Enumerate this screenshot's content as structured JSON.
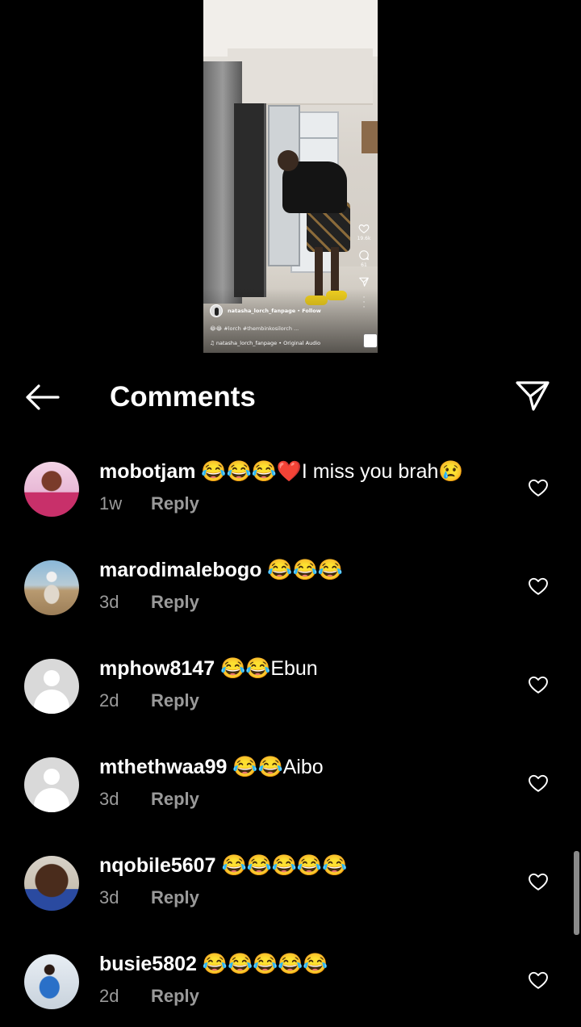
{
  "video": {
    "likes": "19.6k",
    "comments_count": "61",
    "username": "natasha_lorch_fanpage",
    "follow_label": "Follow",
    "caption": "😂😂 #lorch #thembinkosilorch ...",
    "audio": "natasha_lorch_fanpage • Original Audio",
    "music_note": "♫",
    "icons": [
      "heart-icon",
      "comment-icon",
      "share-icon",
      "more-icon",
      "audio-thumbnail"
    ]
  },
  "header": {
    "title": "Comments",
    "back_icon": "arrow-left-icon",
    "send_icon": "paper-plane-icon"
  },
  "comments": [
    {
      "username": "mobotjam",
      "text": "😂😂😂❤️I miss you brah😢",
      "time": "1w",
      "reply": "Reply"
    },
    {
      "username": "marodimalebogo",
      "text": "😂😂😂",
      "time": "3d",
      "reply": "Reply"
    },
    {
      "username": "mphow8147",
      "text": "😂😂Ebun",
      "time": "2d",
      "reply": "Reply"
    },
    {
      "username": "mthethwaa99",
      "text": "😂😂Aibo",
      "time": "3d",
      "reply": "Reply"
    },
    {
      "username": "nqobile5607",
      "text": "😂😂😂😂😂",
      "time": "3d",
      "reply": "Reply"
    },
    {
      "username": "busie5802",
      "text": "😂😂😂😂😂",
      "time": "2d",
      "reply": "Reply"
    }
  ],
  "colors": {
    "background": "#000000",
    "text": "#ffffff",
    "meta": "#9a9a9a"
  }
}
